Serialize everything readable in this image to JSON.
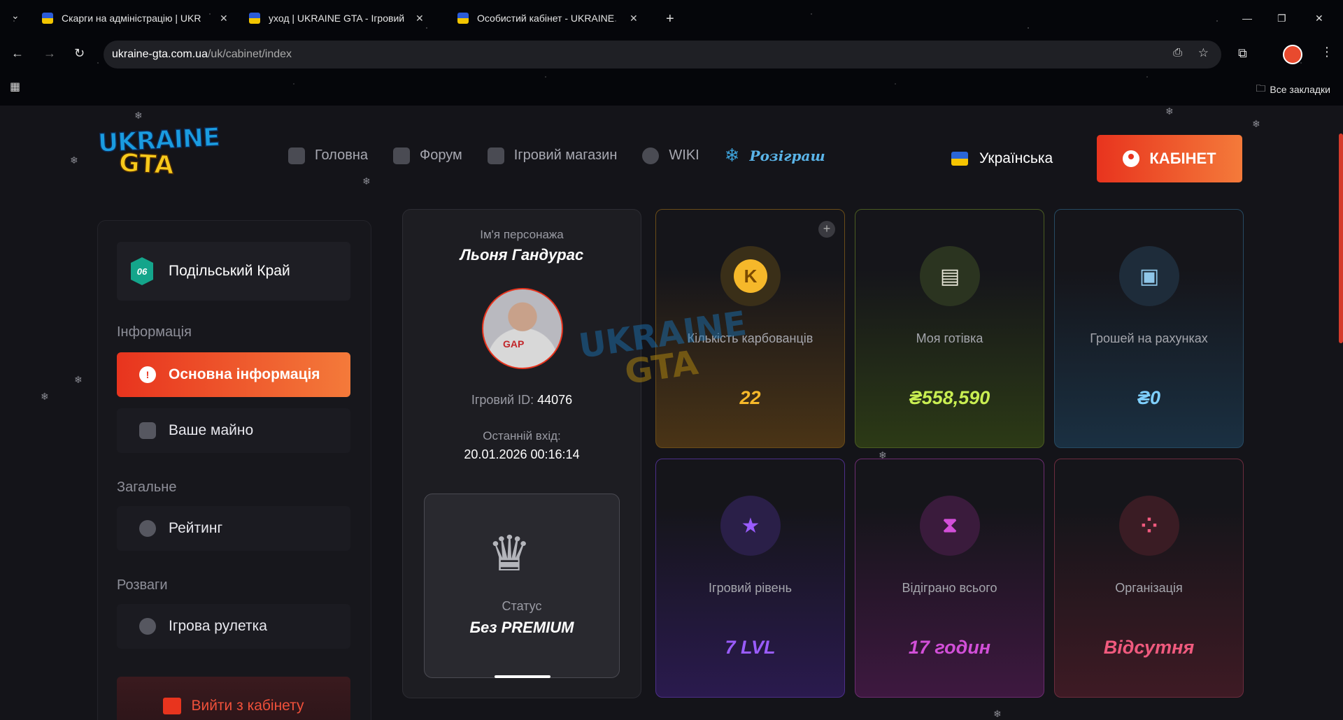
{
  "browser": {
    "tabs": [
      {
        "title": "Скарги на адміністрацію | UKR"
      },
      {
        "title": "уход | UKRAINE GTA - Ігровий"
      },
      {
        "title": "Особистий кабінет - UKRAINE"
      }
    ],
    "url_host": "ukraine-gta.com.ua",
    "url_path": "/uk/cabinet/index",
    "bookmarks_label": "Все закладки"
  },
  "header": {
    "logo_line1": "UKRAINE",
    "logo_line2": "GTA",
    "menu": [
      {
        "label": "Головна",
        "icon": "home-icon"
      },
      {
        "label": "Форум",
        "icon": "hash-icon"
      },
      {
        "label": "Ігровий магазин",
        "icon": "shopping-bag-icon"
      },
      {
        "label": "WIKI",
        "icon": "globe-icon"
      },
      {
        "label": "Розіграш",
        "icon": "snowflake-icon"
      }
    ],
    "language": "Українська",
    "cabinet_button": "КАБІНЕТ"
  },
  "sidebar": {
    "server_badge": "06",
    "server_name": "Подільський Край",
    "sections": [
      {
        "title": "Інформація",
        "items": [
          {
            "label": "Основна інформація",
            "active": true,
            "icon": "alert-icon"
          },
          {
            "label": "Ваше майно",
            "active": false,
            "icon": "car-icon"
          }
        ]
      },
      {
        "title": "Загальне",
        "items": [
          {
            "label": "Рейтинг",
            "active": false,
            "icon": "trophy-icon"
          }
        ]
      },
      {
        "title": "Розваги",
        "items": [
          {
            "label": "Ігрова рулетка",
            "active": false,
            "icon": "roulette-icon"
          }
        ]
      }
    ],
    "logout": "Вийти з кабінету"
  },
  "profile": {
    "name_label": "Ім'я персонажа",
    "name": "Льоня Гандурас",
    "game_id_label": "Ігровий ID:",
    "game_id": "44076",
    "last_login_label": "Останній вхід:",
    "last_login": "20.01.2026 00:16:14",
    "status_label": "Статус",
    "status": "Без PREMIUM"
  },
  "stats": [
    {
      "label": "Кількість карбованців",
      "value": "22",
      "icon": "coin-icon",
      "color": "#f5b82a"
    },
    {
      "label": "Моя готівка",
      "value": "₴558,590",
      "icon": "cash-icon",
      "color": "#c9ee52"
    },
    {
      "label": "Грошей на рахунках",
      "value": "₴0",
      "icon": "safe-icon",
      "color": "#7fd0ff"
    },
    {
      "label": "Ігровий рівень",
      "value": "7 LVL",
      "icon": "star-icon",
      "color": "#9a5cff"
    },
    {
      "label": "Відіграно всього",
      "value": "17 годин",
      "icon": "hourglass-icon",
      "color": "#d24fd8"
    },
    {
      "label": "Організація",
      "value": "Відсутня",
      "icon": "group-icon",
      "color": "#f05a7e"
    }
  ],
  "colors": {
    "accent": "#e8341e",
    "accent2": "#f47a3a"
  }
}
